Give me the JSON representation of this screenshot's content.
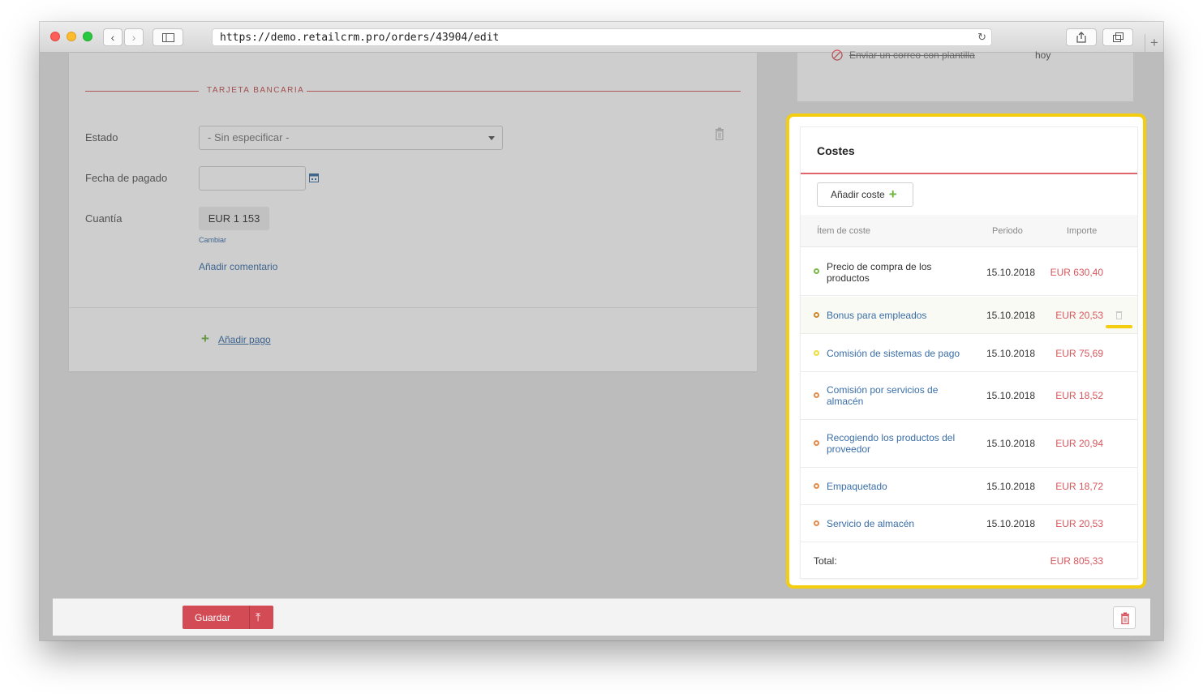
{
  "browser": {
    "url": "https://demo.retailcrm.pro/orders/43904/edit"
  },
  "payment": {
    "section_title": "TARJETA BANCARIA",
    "estado_label": "Estado",
    "estado_value": "- Sin especificar -",
    "fecha_label": "Fecha de pagado",
    "fecha_value": "",
    "cuantia_label": "Cuantía",
    "cuantia_value": "EUR 1 153",
    "cambiar_link": "Cambiar",
    "comment_link": "Añadir comentario",
    "add_payment_link": "Añadir pago"
  },
  "task": {
    "text": "Enviar un correo con plantilla",
    "when": "hoy"
  },
  "costs": {
    "title": "Costes",
    "add_button": "Añadir coste",
    "columns": {
      "item": "Ítem de coste",
      "period": "Periodo",
      "amount": "Importe"
    },
    "rows": [
      {
        "name": "Precio de compra de los productos",
        "period": "15.10.2018",
        "amount": "EUR 630,40",
        "dot_color": "#7ab648",
        "name_color": "#333333"
      },
      {
        "name": "Bonus para empleados",
        "period": "15.10.2018",
        "amount": "EUR 20,53",
        "dot_color": "#c98a2e",
        "name_color": "#3a6ea8"
      },
      {
        "name": "Comisión de sistemas de pago",
        "period": "15.10.2018",
        "amount": "EUR 75,69",
        "dot_color": "#eedd3a",
        "name_color": "#3a6ea8"
      },
      {
        "name": "Comisión por servicios de almacén",
        "period": "15.10.2018",
        "amount": "EUR 18,52",
        "dot_color": "#e38a4b",
        "name_color": "#3a6ea8"
      },
      {
        "name": "Recogiendo los productos del proveedor",
        "period": "15.10.2018",
        "amount": "EUR 20,94",
        "dot_color": "#e38a4b",
        "name_color": "#3a6ea8"
      },
      {
        "name": "Empaquetado",
        "period": "15.10.2018",
        "amount": "EUR 18,72",
        "dot_color": "#e38a4b",
        "name_color": "#3a6ea8"
      },
      {
        "name": "Servicio de almacén",
        "period": "15.10.2018",
        "amount": "EUR 20,53",
        "dot_color": "#e38a4b",
        "name_color": "#3a6ea8"
      }
    ],
    "total_label": "Total:",
    "total_value": "EUR 805,33"
  },
  "footer": {
    "save_button": "Guardar"
  },
  "colors": {
    "accent_red": "#d24b55",
    "highlight_yellow": "#f5cd0f",
    "link_blue": "#3a6ea8"
  }
}
